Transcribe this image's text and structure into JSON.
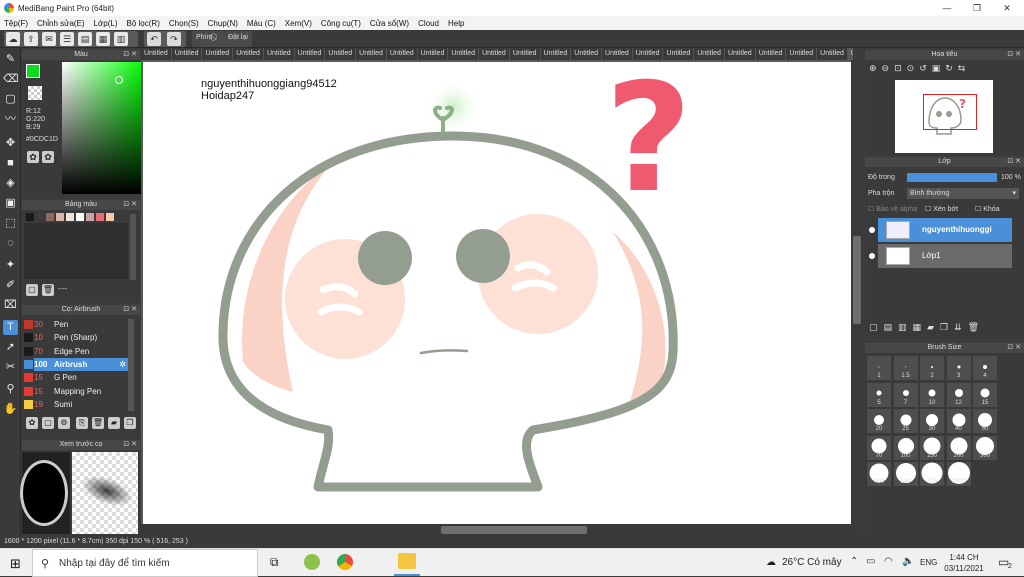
{
  "window": {
    "title": "MediBang Paint Pro (64bit)"
  },
  "menu": [
    "Tệp(F)",
    "Chỉnh sửa(E)",
    "Lớp(L)",
    "Bộ lọc(R)",
    "Chọn(S)",
    "Chụp(N)",
    "Màu (C)",
    "Xem(V)",
    "Công cụ(T)",
    "Cửa sổ(W)",
    "Cloud",
    "Help"
  ],
  "toolbar": {
    "snap_label": "Phím",
    "reset_label": "Đặt lại"
  },
  "color_panel": {
    "title": "Màu",
    "r": "R:12",
    "g": "G:220",
    "b": "B:29",
    "hex": "#0CDC1D",
    "fg": "#0cdc1d"
  },
  "swatch_panel": {
    "title": "Bảng màu",
    "footer": "----",
    "swatches": [
      "#1a1a1a",
      "#3b3b3b",
      "#8a6b5c",
      "#d9b8a8",
      "#f0e2d6",
      "#ffffff",
      "#c9a3a3",
      "#e86b7a",
      "#f5c8a8"
    ]
  },
  "brush_panel": {
    "title": "Cọ: Airbrush",
    "items": [
      {
        "size": "30",
        "name": "Pen",
        "color": "#c0392b"
      },
      {
        "size": "10",
        "name": "Pen (Sharp)",
        "color": "#1a1a1a"
      },
      {
        "size": "70",
        "name": "Edge Pen",
        "color": "#1a1a1a"
      },
      {
        "size": "100",
        "name": "Airbrush",
        "color": "#4a90d9"
      },
      {
        "size": "15",
        "name": "G Pen",
        "color": "#e53935"
      },
      {
        "size": "15",
        "name": "Mapping Pen",
        "color": "#e53935"
      },
      {
        "size": "19",
        "name": "Sumi",
        "color": "#f4d03f"
      }
    ]
  },
  "preview_panel": {
    "title": "Xem trước cọ"
  },
  "tabs": {
    "label": "Untitled",
    "count": 24
  },
  "canvas": {
    "text_line1": "nguyenthihuonggiang94512",
    "text_line2": "Hoidap247",
    "question_mark": "?"
  },
  "navigator": {
    "title": "Hoa tiêu"
  },
  "layer_panel": {
    "title": "Lớp",
    "opacity_label": "Độ trong",
    "opacity_value": "100 %",
    "blend_label": "Pha trộn",
    "blend_value": "Bình thường",
    "protect_alpha": "Bảo vệ alpha",
    "clipping": "Xén bớt",
    "lock": "Khóa",
    "layers": [
      {
        "name": "nguyenthihuonggi",
        "selected": true
      },
      {
        "name": "Lớp1",
        "selected": false
      }
    ]
  },
  "brush_size_panel": {
    "title": "Brush Size",
    "sizes": [
      "1",
      "1.5",
      "2",
      "3",
      "4",
      "5",
      "7",
      "10",
      "12",
      "15",
      "20",
      "25",
      "30",
      "40",
      "50",
      "70",
      "100",
      "150",
      "200",
      "300",
      "400",
      "500",
      "700",
      "1000"
    ]
  },
  "status": {
    "text": "1600 * 1200 pixel   (11.6 * 8.7cm)   350 dpi   150 %   ( 516, 253 )"
  },
  "taskbar": {
    "search_placeholder": "Nhập tại đây để tìm kiếm",
    "weather": "26°C  Có mây",
    "language": "ENG",
    "time": "1:44 CH",
    "date": "03/11/2021",
    "notifications": "2"
  }
}
